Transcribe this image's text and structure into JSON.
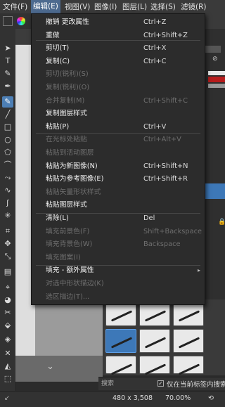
{
  "menubar": {
    "items": [
      "文件(F)",
      "编辑(E)",
      "视图(V)",
      "图像(I)",
      "图层(L)",
      "选择(S)",
      "滤镜(R)"
    ],
    "active_index": 1
  },
  "menu": {
    "items": [
      {
        "label": "撤销 更改属性",
        "shortcut": "Ctrl+Z",
        "enabled": true
      },
      {
        "label": "重做",
        "shortcut": "Ctrl+Shift+Z",
        "enabled": true
      },
      {
        "label": "剪切(T)",
        "shortcut": "Ctrl+X",
        "enabled": true
      },
      {
        "label": "复制(C)",
        "shortcut": "Ctrl+C",
        "enabled": true
      },
      {
        "label": "剪切(锐利)(S)",
        "shortcut": "",
        "enabled": false
      },
      {
        "label": "复制(锐利)(O)",
        "shortcut": "",
        "enabled": false
      },
      {
        "label": "合并复制(M)",
        "shortcut": "Ctrl+Shift+C",
        "enabled": false
      },
      {
        "label": "复制图层样式",
        "shortcut": "",
        "enabled": true
      },
      {
        "label": "粘贴(P)",
        "shortcut": "Ctrl+V",
        "enabled": true
      },
      {
        "label": "在光标处粘贴",
        "shortcut": "Ctrl+Alt+V",
        "enabled": false
      },
      {
        "label": "粘贴到活动图层",
        "shortcut": "",
        "enabled": false
      },
      {
        "label": "粘贴为新图像(N)",
        "shortcut": "Ctrl+Shift+N",
        "enabled": true
      },
      {
        "label": "粘贴为参考图像(E)",
        "shortcut": "Ctrl+Shift+R",
        "enabled": true
      },
      {
        "label": "粘贴矢量形状样式",
        "shortcut": "",
        "enabled": false
      },
      {
        "label": "粘贴图层样式",
        "shortcut": "",
        "enabled": true
      },
      {
        "label": "清除(L)",
        "shortcut": "Del",
        "enabled": true
      },
      {
        "label": "填充前景色(F)",
        "shortcut": "Shift+Backspace",
        "enabled": false
      },
      {
        "label": "填充背景色(W)",
        "shortcut": "Backspace",
        "enabled": false
      },
      {
        "label": "填充图案(I)",
        "shortcut": "",
        "enabled": false
      },
      {
        "label": "填充 - 额外属性",
        "shortcut": "",
        "enabled": true,
        "submenu": true
      },
      {
        "label": "对选中形状描边(K)",
        "shortcut": "",
        "enabled": false
      },
      {
        "label": "选区描边(T)...",
        "shortcut": "",
        "enabled": false
      }
    ]
  },
  "docker": {
    "search_placeholder": "搜索",
    "filter_checkbox_label": "仅在当前标签内搜索",
    "filter_checked": true
  },
  "statusbar": {
    "size": "480 x 3,508",
    "zoom": "70.00%"
  },
  "colors": {
    "accent": "#3f5f86",
    "menu_bg": "#2c2c2c",
    "disabled_text": "#6e6e6e"
  }
}
